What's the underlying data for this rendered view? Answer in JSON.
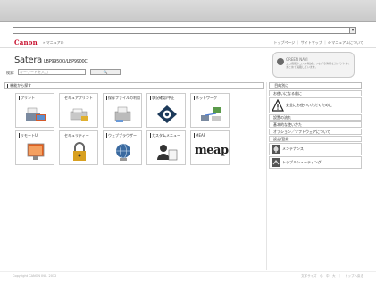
{
  "browser": {
    "dropdown_arrow": "▾"
  },
  "header": {
    "logo": "Canon",
    "crumb": "» マニュアル",
    "links": "トップページ ｜ サイトマップ ｜ e-マニュアルについて"
  },
  "product": {
    "brand": "Satera",
    "model": "LBP9950Ci/LBP9900Ci"
  },
  "search": {
    "label": "検索:",
    "placeholder": "キーワードを入力",
    "button": "🔍"
  },
  "green": {
    "title": "GREEN NAVI",
    "text": "エコ機能やコスト削減につながる情報を分かりやすくまとめて掲載しています。"
  },
  "left_section": {
    "title": "機能から探す"
  },
  "tiles_row1": [
    {
      "label": "プリント",
      "icon": "print-icon"
    },
    {
      "label": "セキュアプリント",
      "icon": "secure-print-icon"
    },
    {
      "label": "保存ファイルの利用",
      "icon": "stored-file-icon"
    },
    {
      "label": "状況確認/中止",
      "icon": "status-icon"
    },
    {
      "label": "ネットワーク",
      "icon": "network-icon"
    }
  ],
  "tiles_row2": [
    {
      "label": "リモートUI",
      "icon": "remote-ui-icon"
    },
    {
      "label": "セキュリティー",
      "icon": "security-icon"
    },
    {
      "label": "ウェブブラウザー",
      "icon": "web-browser-icon"
    },
    {
      "label": "カスタムメニュー",
      "icon": "custom-menu-icon"
    },
    {
      "label": "MEAP",
      "icon": "meap-icon",
      "logo_text": "meap"
    }
  ],
  "right_section": {
    "title": "目的別に"
  },
  "right_items": [
    {
      "label": "お使いになる前に",
      "type": "small"
    },
    {
      "label": "安全にお使いいただくために",
      "type": "big",
      "icon": "warning-icon"
    },
    {
      "label": "設置の流れ",
      "type": "small"
    },
    {
      "label": "基本的な使いかた",
      "type": "small"
    },
    {
      "label": "オプション／ソフトウェアについて",
      "type": "small"
    },
    {
      "label": "設定/登録",
      "type": "small"
    },
    {
      "label": "メンテナンス",
      "type": "mid",
      "icon": "maintenance-icon"
    },
    {
      "label": "トラブルシューティング",
      "type": "mid",
      "icon": "troubleshooting-icon"
    }
  ],
  "footer": {
    "left": "Copyright CANON INC. 2012",
    "right": "文字サイズ　小　中　大　｜　トップへ戻る"
  }
}
